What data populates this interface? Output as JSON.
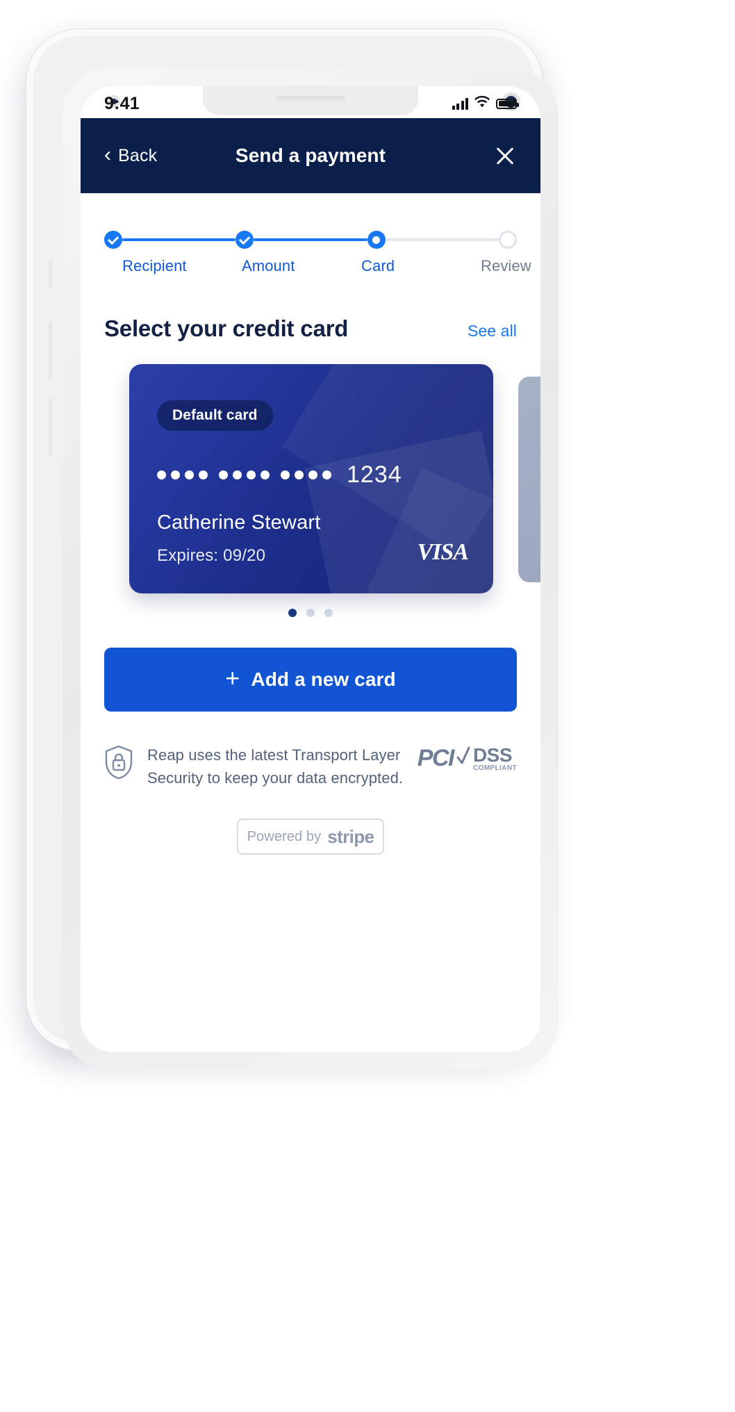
{
  "status_bar": {
    "time": "9:41",
    "signal_icon": "cellular-signal-icon",
    "wifi_icon": "wifi-icon",
    "battery_icon": "battery-full-icon"
  },
  "nav": {
    "back_label": "Back",
    "back_icon": "chevron-left-icon",
    "title": "Send a payment",
    "close_icon": "close-icon"
  },
  "stepper": {
    "steps": [
      {
        "label": "Recipient",
        "state": "done"
      },
      {
        "label": "Amount",
        "state": "done"
      },
      {
        "label": "Card",
        "state": "current"
      },
      {
        "label": "Review",
        "state": "todo"
      }
    ]
  },
  "section": {
    "title": "Select your credit card",
    "see_all_label": "See all"
  },
  "card": {
    "badge_label": "Default card",
    "masked_groups": [
      "••••",
      "••••",
      "••••"
    ],
    "last4": "1234",
    "holder_name": "Catherine Stewart",
    "expiry_label": "Expires: 09/20",
    "brand": "VISA"
  },
  "pager": {
    "total": 3,
    "active_index": 0
  },
  "add_card": {
    "label": "Add a new card",
    "plus_icon": "plus-icon"
  },
  "security": {
    "shield_icon": "shield-lock-icon",
    "text": "Reap uses the latest Transport Layer Security to keep your data encrypted.",
    "pci_word": "PCI",
    "dss_word": "DSS",
    "compliant_word": "COMPLIANT"
  },
  "stripe": {
    "powered_by": "Powered by",
    "brand": "stripe"
  },
  "colors": {
    "nav_navy": "#0a1f49",
    "accent_blue": "#1877f2",
    "button_blue": "#1155d4",
    "card_blue_start": "#2b3fa8",
    "card_blue_end": "#192776",
    "muted_text": "#52627d"
  }
}
